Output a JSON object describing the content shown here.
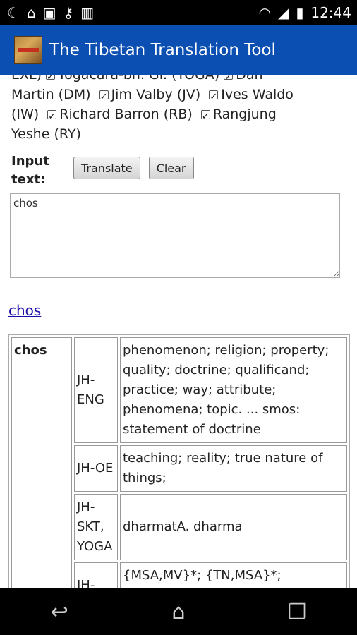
{
  "status_bar": {
    "time": "12:44",
    "left_icons": [
      "moon-icon",
      "home-icon",
      "image-icon",
      "key-icon",
      "barcode-icon"
    ],
    "right_icons": [
      "wifi-icon",
      "signal-icon",
      "battery-icon"
    ]
  },
  "app_bar": {
    "title": "The Tibetan Translation Tool"
  },
  "dictionaries": {
    "line1_prefix": "EXL)",
    "items": [
      {
        "label": "Yogacara-bh. Gl. (YOGA)",
        "checked": true
      },
      {
        "label": "Dan Martin (DM)",
        "checked": true
      },
      {
        "label": "Jim Valby (JV)",
        "checked": true
      },
      {
        "label": "Ives Waldo (IW)",
        "checked": true
      },
      {
        "label": "Richard Barron (RB)",
        "checked": true
      },
      {
        "label": "Rangjung Yeshe (RY)",
        "checked": true
      }
    ],
    "dan_part1": "Dan",
    "dan_part2": "Martin (DM)",
    "ives_part1": "Ives Waldo",
    "ives_part2": "(IW)",
    "rangjung_part1": "Rangjung",
    "rangjung_part2": "Yeshe (RY)"
  },
  "input": {
    "label": "Input text:",
    "translate_label": "Translate",
    "clear_label": "Clear",
    "value": "chos"
  },
  "result_link": "chos",
  "results": {
    "term": "chos",
    "rows": [
      {
        "source": "JH-ENG",
        "definition": "phenomenon; religion; property; quality; doctrine; qualificand; practice; way; attribute; phenomena; topic. ... smos: statement of doctrine"
      },
      {
        "source": "JH-OE",
        "definition": "teaching; reality; true nature of things;"
      },
      {
        "source": "JH-SKT, YOGA",
        "definition": "dharmatA. dharma"
      },
      {
        "source": "JH-",
        "definition": "{MSA,MV}*; {TN,MSA}*; {MSA}dharama ... smos:"
      }
    ]
  }
}
